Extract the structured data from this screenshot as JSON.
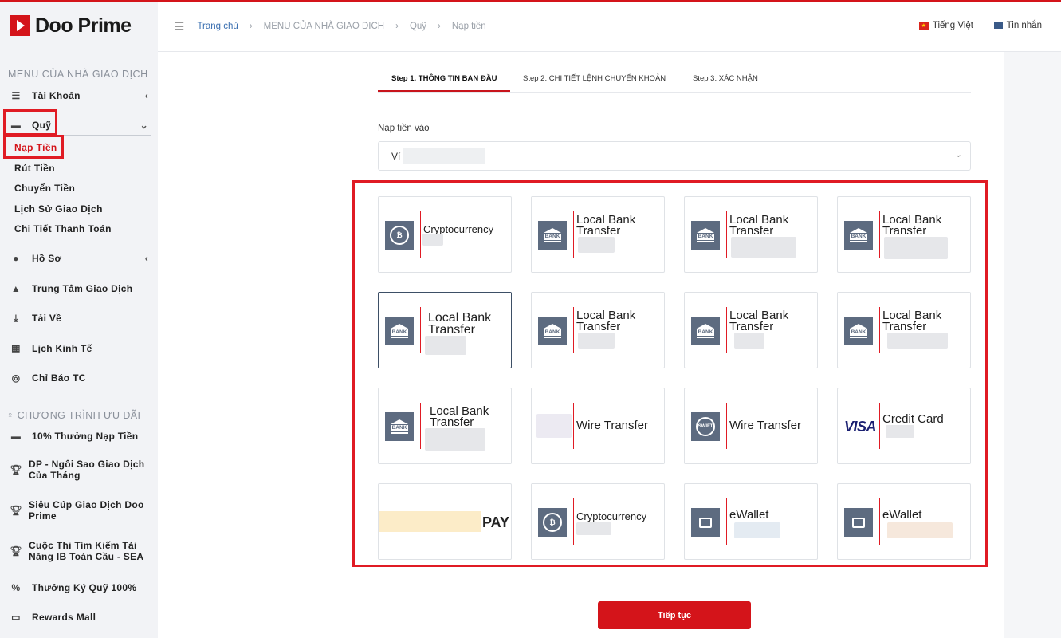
{
  "brand": {
    "name": "Doo Prime"
  },
  "sidebar": {
    "menu_title": "MENU CỦA NHÀ GIAO DỊCH",
    "items": [
      {
        "label": "Tài Khoản",
        "icon": "list-icon"
      },
      {
        "label": "Quỹ",
        "icon": "wallet-icon"
      },
      {
        "label": "Hồ Sơ",
        "icon": "user-icon"
      },
      {
        "label": "Trung Tâm Giao Dịch",
        "icon": "chart-icon"
      },
      {
        "label": "Tải Về",
        "icon": "download-icon"
      },
      {
        "label": "Lịch Kinh Tế",
        "icon": "calendar-icon"
      },
      {
        "label": "Chỉ Báo TC",
        "icon": "target-icon"
      }
    ],
    "sub_items": [
      "Nạp Tiền",
      "Rút Tiền",
      "Chuyển Tiền",
      "Lịch Sử Giao Dịch",
      "Chi Tiết Thanh Toán"
    ],
    "promo_title": "CHƯƠNG TRÌNH ƯU ĐÃI",
    "promo_items": [
      {
        "label": "10% Thưởng Nạp Tiền",
        "icon": "wallet-icon"
      },
      {
        "label": "DP - Ngôi Sao Giao Dịch Của Tháng",
        "icon": "trophy-icon"
      },
      {
        "label": "Siêu Cúp Giao Dịch Doo Prime",
        "icon": "trophy-icon"
      },
      {
        "label": "Cuộc Thi Tìm Kiếm Tài Năng IB Toàn Cầu - SEA",
        "icon": "trophy-icon"
      },
      {
        "label": "Thưởng Ký Quỹ 100%",
        "icon": "percent-icon"
      },
      {
        "label": "Rewards Mall",
        "icon": "store-icon"
      }
    ]
  },
  "header": {
    "breadcrumbs": [
      "Trang chủ",
      "MENU CỦA NHÀ GIAO DỊCH",
      "Quỹ",
      "Nạp tiền"
    ],
    "language": "Tiếng Việt",
    "messages": "Tin nhắn"
  },
  "steps": [
    "Step 1. THÔNG TIN BAN ĐẦU",
    "Step 2. CHI TIẾT LỆNH CHUYỂN KHOẢN",
    "Step 3. XÁC NHẬN"
  ],
  "deposit": {
    "label": "Nạp tiền vào",
    "selected_value": "Ví"
  },
  "methods": [
    {
      "name": "Cryptocurrency",
      "icon": "crypto-coin-icon"
    },
    {
      "name": "Local Bank Transfer",
      "icon": "bank-icon"
    },
    {
      "name": "Local Bank Transfer",
      "icon": "bank-icon"
    },
    {
      "name": "Local Bank Transfer",
      "icon": "bank-icon"
    },
    {
      "name": "Local Bank Transfer",
      "icon": "bank-icon"
    },
    {
      "name": "Local Bank Transfer",
      "icon": "bank-icon"
    },
    {
      "name": "Local Bank Transfer",
      "icon": "bank-icon"
    },
    {
      "name": "Local Bank Transfer",
      "icon": "bank-icon"
    },
    {
      "name": "Local Bank Transfer",
      "icon": "bank-icon"
    },
    {
      "name": "Wire Transfer",
      "icon": "blurred-logo-icon"
    },
    {
      "name": "Wire Transfer",
      "icon": "swift-icon"
    },
    {
      "name": "Credit Card",
      "icon": "visa-logo-icon",
      "logo_text": "VISA"
    },
    {
      "name": "PAY",
      "icon": "pay-logo-icon"
    },
    {
      "name": "Cryptocurrency",
      "icon": "crypto-coin-icon"
    },
    {
      "name": "eWallet",
      "icon": "wallet-icon"
    },
    {
      "name": "eWallet",
      "icon": "wallet-icon"
    }
  ],
  "selected_method_index": 4,
  "continue_button": "Tiếp tục",
  "colors": {
    "accent": "#d4141a",
    "icon_bg": "#5d6b80",
    "highlight_box": "#e01b24"
  }
}
